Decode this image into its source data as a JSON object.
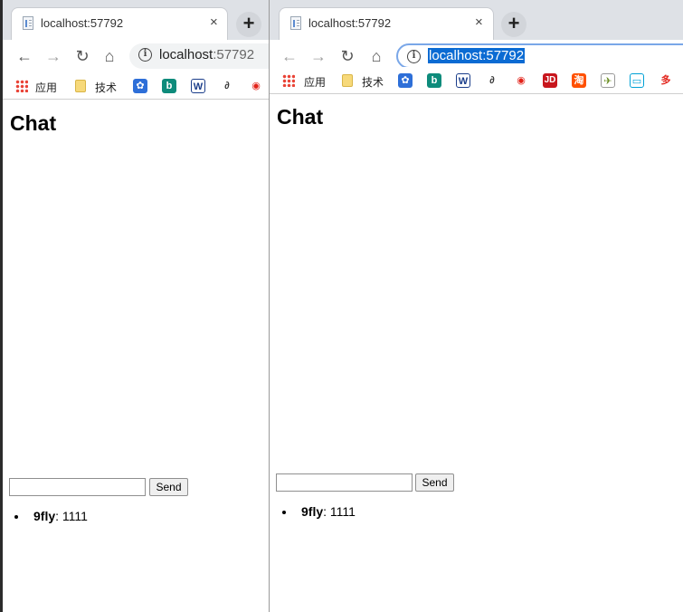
{
  "windows": [
    {
      "tab_title": "localhost:57792",
      "url_host": "localhost",
      "url_port": ":57792",
      "bookmarks": {
        "apps": "应用",
        "tech": "技术"
      },
      "page_title": "Chat",
      "send_label": "Send",
      "messages": [
        {
          "user": "9fly",
          "text": ": 1111"
        }
      ]
    },
    {
      "tab_title": "localhost:57792",
      "url_host": "localhost",
      "url_port": ":57792",
      "bookmarks": {
        "apps": "应用",
        "tech": "技术"
      },
      "page_title": "Chat",
      "send_label": "Send",
      "messages": [
        {
          "user": "9fly",
          "text": ": 1111"
        }
      ]
    }
  ],
  "icons": {
    "back": "←",
    "forward": "→",
    "reload": "↻",
    "home": "⌂",
    "close": "×",
    "new_tab": "+",
    "info": "i"
  },
  "colors": {
    "selection": "#0b6bd3",
    "tabstrip": "#dee1e6"
  }
}
